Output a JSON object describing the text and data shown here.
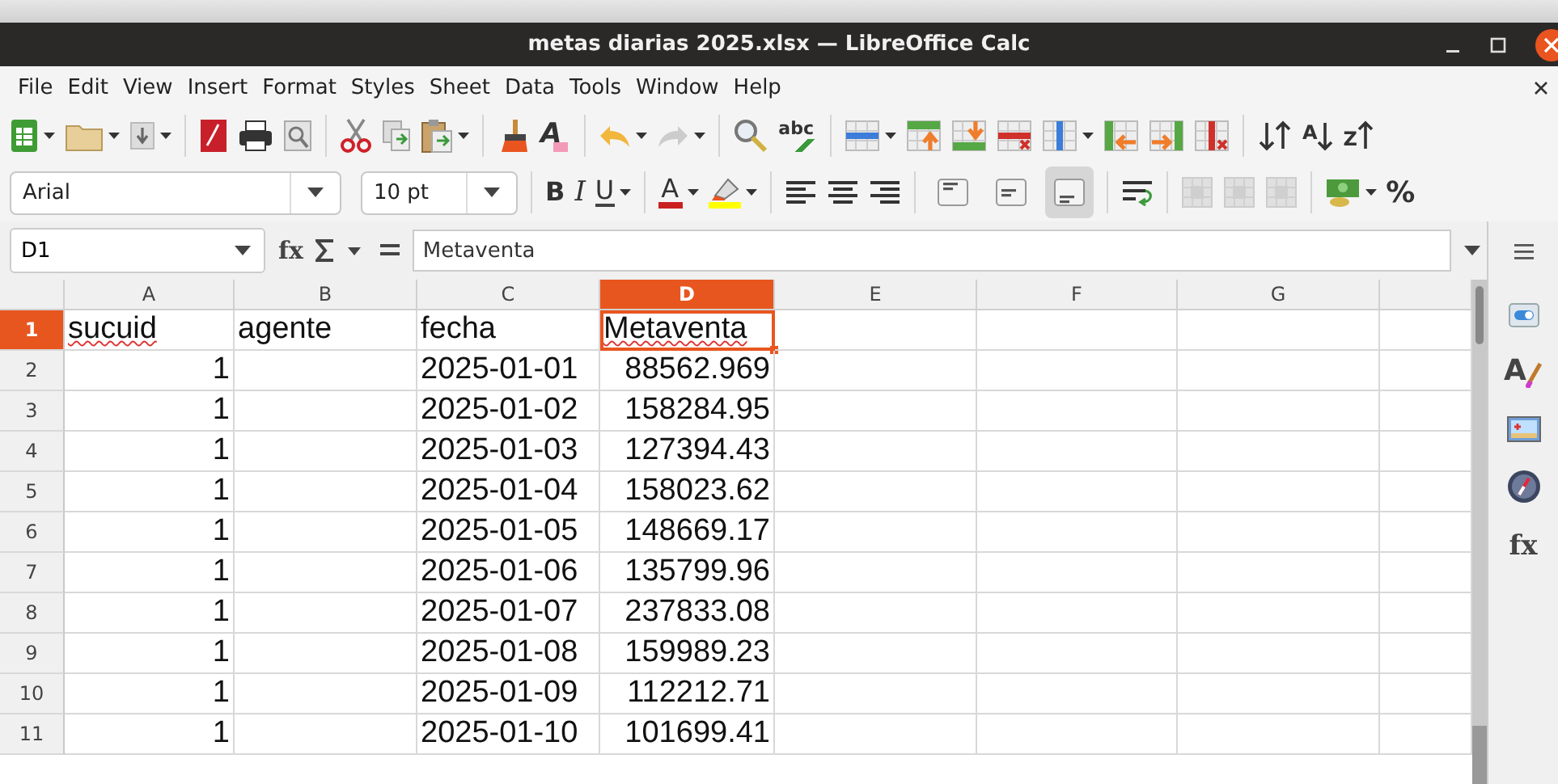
{
  "window": {
    "title": "metas diarias 2025.xlsx — LibreOffice Calc"
  },
  "icon_glyphs": {
    "clear_formatting": "A",
    "spellcheck": "abc",
    "sort_ascending": "A",
    "sort_descending": "Z",
    "bold": "B",
    "italic": "I",
    "underline": "U",
    "font_color": "A",
    "function_wizard": "fx",
    "styles": "A",
    "functions": "fx"
  },
  "menu": [
    "File",
    "Edit",
    "View",
    "Insert",
    "Format",
    "Styles",
    "Sheet",
    "Data",
    "Tools",
    "Window",
    "Help"
  ],
  "formatting": {
    "font_name": "Arial",
    "font_size": "10 pt",
    "vertical_align": [
      {
        "kind": "top",
        "selected": false
      },
      {
        "kind": "center",
        "selected": false
      },
      {
        "kind": "bottom",
        "selected": true
      }
    ],
    "currency": "%"
  },
  "formula_bar": {
    "name_box": "D1",
    "value": "Metaventa"
  },
  "columns": [
    {
      "label": "A",
      "selected": false
    },
    {
      "label": "B",
      "selected": false
    },
    {
      "label": "C",
      "selected": false
    },
    {
      "label": "D",
      "selected": true
    },
    {
      "label": "E",
      "selected": false
    },
    {
      "label": "F",
      "selected": false
    },
    {
      "label": "G",
      "selected": false
    }
  ],
  "rows": [
    {
      "label": "1",
      "selected": true,
      "cells": [
        {
          "text": "sucuid",
          "kind": "text",
          "misspelled": true
        },
        {
          "text": "agente",
          "kind": "text",
          "misspelled": false
        },
        {
          "text": "fecha",
          "kind": "text",
          "misspelled": false
        },
        {
          "text": "Metaventa",
          "kind": "text",
          "misspelled": true,
          "selected": true
        }
      ]
    },
    {
      "label": "2",
      "selected": false,
      "cells": [
        {
          "text": "1",
          "kind": "number"
        },
        null,
        {
          "text": "2025-01-01",
          "kind": "text"
        },
        {
          "text": "88562.969",
          "kind": "number"
        }
      ]
    },
    {
      "label": "3",
      "selected": false,
      "cells": [
        {
          "text": "1",
          "kind": "number"
        },
        null,
        {
          "text": "2025-01-02",
          "kind": "text"
        },
        {
          "text": "158284.95",
          "kind": "number"
        }
      ]
    },
    {
      "label": "4",
      "selected": false,
      "cells": [
        {
          "text": "1",
          "kind": "number"
        },
        null,
        {
          "text": "2025-01-03",
          "kind": "text"
        },
        {
          "text": "127394.43",
          "kind": "number"
        }
      ]
    },
    {
      "label": "5",
      "selected": false,
      "cells": [
        {
          "text": "1",
          "kind": "number"
        },
        null,
        {
          "text": "2025-01-04",
          "kind": "text"
        },
        {
          "text": "158023.62",
          "kind": "number"
        }
      ]
    },
    {
      "label": "6",
      "selected": false,
      "cells": [
        {
          "text": "1",
          "kind": "number"
        },
        null,
        {
          "text": "2025-01-05",
          "kind": "text"
        },
        {
          "text": "148669.17",
          "kind": "number"
        }
      ]
    },
    {
      "label": "7",
      "selected": false,
      "cells": [
        {
          "text": "1",
          "kind": "number"
        },
        null,
        {
          "text": "2025-01-06",
          "kind": "text"
        },
        {
          "text": "135799.96",
          "kind": "number"
        }
      ]
    },
    {
      "label": "8",
      "selected": false,
      "cells": [
        {
          "text": "1",
          "kind": "number"
        },
        null,
        {
          "text": "2025-01-07",
          "kind": "text"
        },
        {
          "text": "237833.08",
          "kind": "number"
        }
      ]
    },
    {
      "label": "9",
      "selected": false,
      "cells": [
        {
          "text": "1",
          "kind": "number"
        },
        null,
        {
          "text": "2025-01-08",
          "kind": "text"
        },
        {
          "text": "159989.23",
          "kind": "number"
        }
      ]
    },
    {
      "label": "10",
      "selected": false,
      "cells": [
        {
          "text": "1",
          "kind": "number"
        },
        null,
        {
          "text": "2025-01-09",
          "kind": "text"
        },
        {
          "text": "112212.71",
          "kind": "number"
        }
      ]
    },
    {
      "label": "11",
      "selected": false,
      "cells": [
        {
          "text": "1",
          "kind": "number"
        },
        null,
        {
          "text": "2025-01-10",
          "kind": "text"
        },
        {
          "text": "101699.41",
          "kind": "number"
        }
      ]
    }
  ]
}
